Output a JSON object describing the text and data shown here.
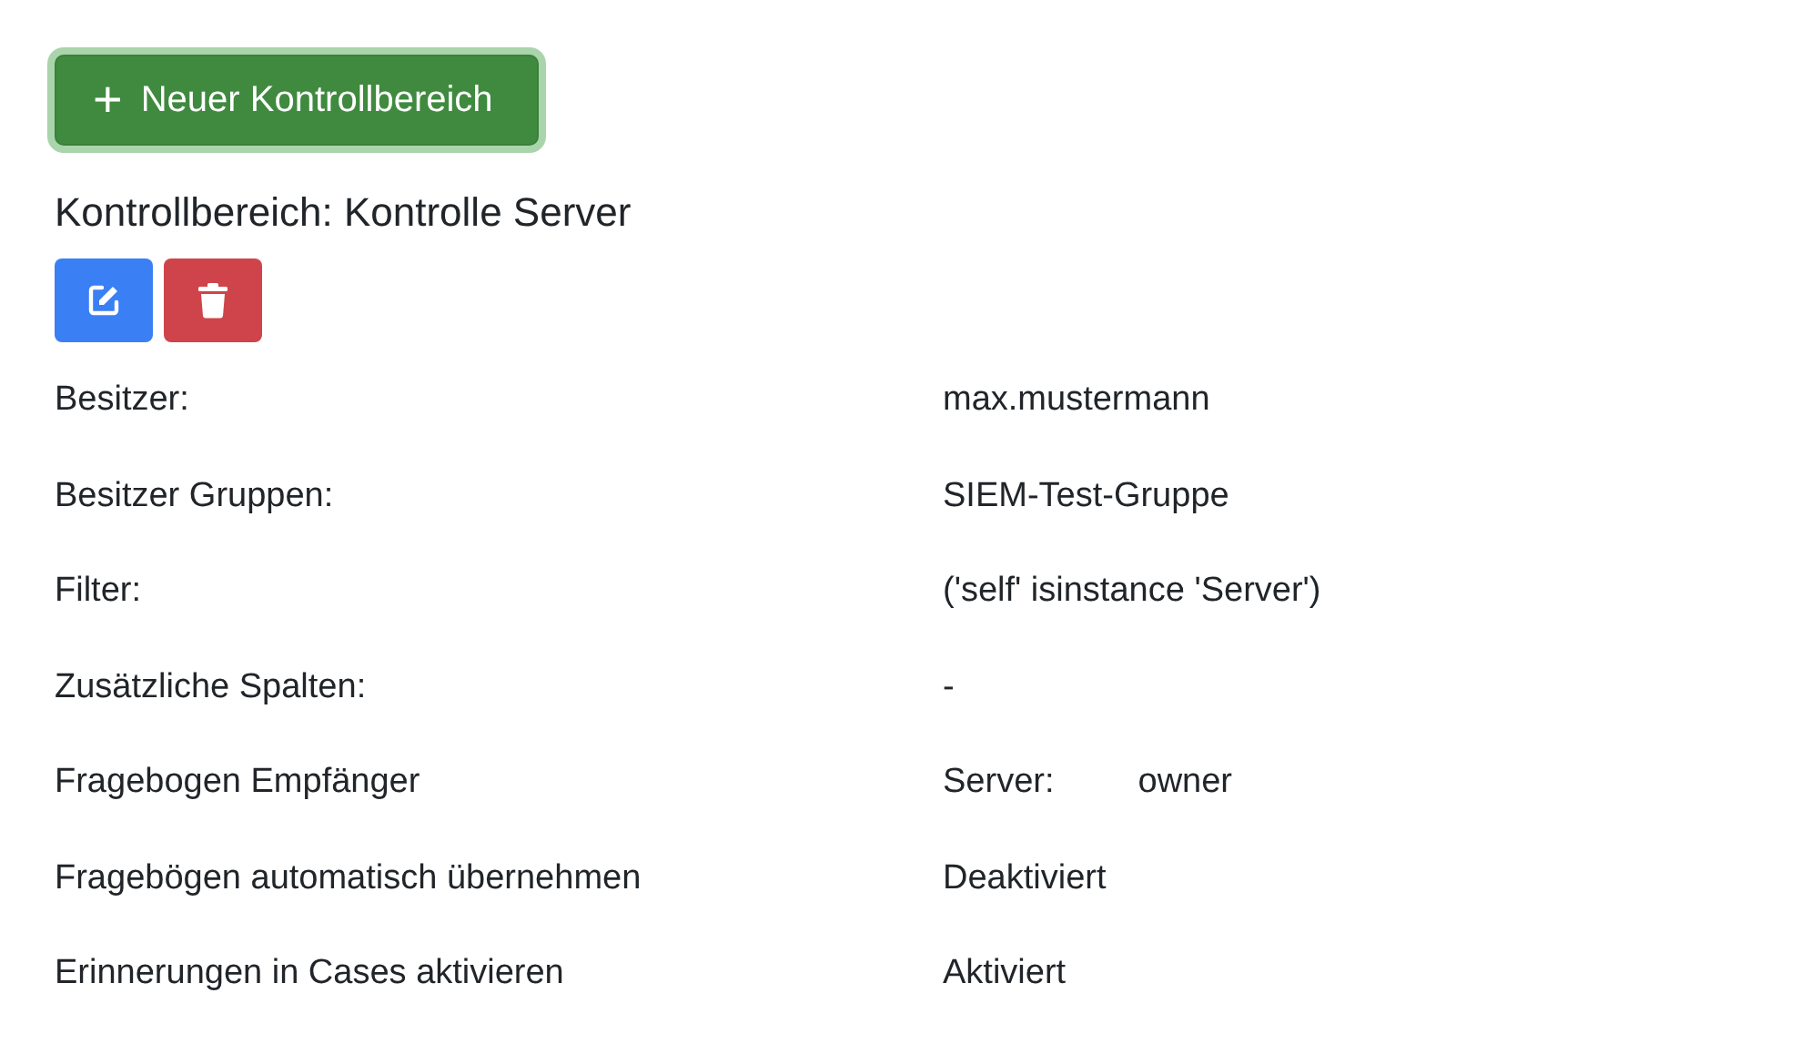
{
  "new_button": {
    "icon": "+",
    "label": "Neuer Kontrollbereich",
    "focused": true
  },
  "title": "Kontrollbereich: Kontrolle Server",
  "actions": [
    {
      "kind": "edit"
    },
    {
      "kind": "delete"
    }
  ],
  "details": [
    {
      "label": "Besitzer:",
      "values": [
        "max.mustermann"
      ]
    },
    {
      "label": "Besitzer Gruppen:",
      "values": [
        "SIEM-Test-Gruppe"
      ]
    },
    {
      "label": "Filter:",
      "values": [
        "('self' isinstance 'Server')"
      ]
    },
    {
      "label": "Zusätzliche Spalten:",
      "values": [
        "-"
      ]
    },
    {
      "label": "Fragebogen Empfänger",
      "values": [
        "Server:",
        "owner"
      ]
    },
    {
      "label": "Fragebögen automatisch übernehmen",
      "values": [
        "Deaktiviert"
      ]
    },
    {
      "label": "Erinnerungen in Cases aktivieren",
      "values": [
        "Aktiviert"
      ]
    }
  ]
}
